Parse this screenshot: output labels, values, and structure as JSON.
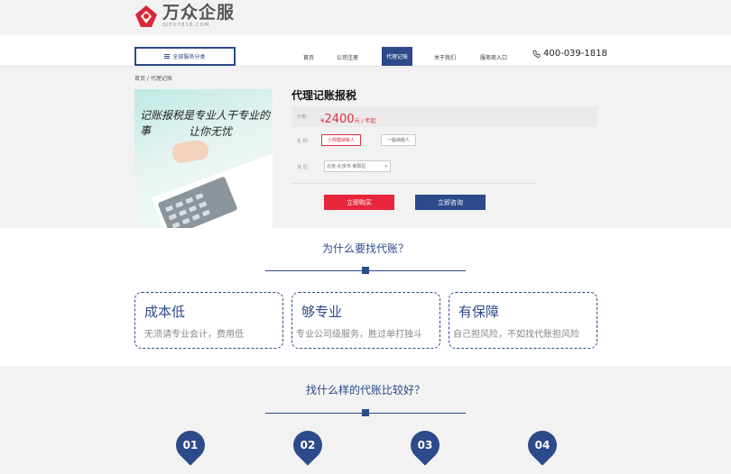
{
  "brand": {
    "name": "万众企服",
    "sub": "QIFU7818.COM",
    "color": "#d8283a"
  },
  "nav": {
    "all_services": "全部服务分类",
    "links": [
      "首页",
      "公司注册",
      "代理记账",
      "关于我们",
      "服务商入口"
    ],
    "active": "代理记账",
    "phone": "400-039-1818"
  },
  "breadcrumb": "首页 / 代理记账",
  "product": {
    "image_text_1": "记账报税是专业人干专业的事",
    "image_text_2": "让你无忧",
    "title": "代理记账报税",
    "price_label": "价格：",
    "price_symbol": "¥",
    "price": "2400",
    "price_unit": "元 / 年起",
    "name_label": "名   称：",
    "options": [
      "小规模纳税人",
      "一般纳税人"
    ],
    "selected_option": "小规模纳税人",
    "region_label": "地   区：",
    "region_value": "北京-北京市-朝阳区",
    "buy_label": "立即购买",
    "consult_label": "立即咨询"
  },
  "why": {
    "title": "为什么要找代账？",
    "cards": [
      {
        "title": "成本低",
        "desc": "无须请专业会计，费用低"
      },
      {
        "title": "够专业",
        "desc": "专业公司级服务，胜过单打独斗"
      },
      {
        "title": "有保障",
        "desc": "自己担风险，不如找代账担风险"
      }
    ]
  },
  "which": {
    "title": "找什么样的代账比较好？",
    "steps": [
      "01",
      "02",
      "03",
      "04"
    ]
  },
  "colors": {
    "primary": "#2d4a8a",
    "accent": "#e7263c"
  }
}
